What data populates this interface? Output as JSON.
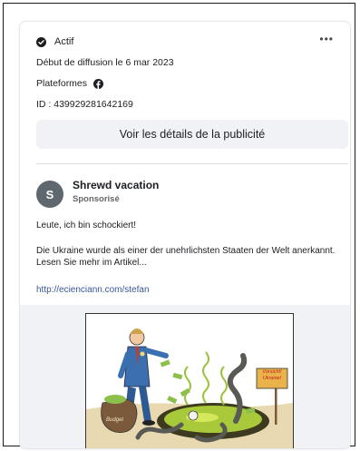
{
  "status": {
    "label": "Actif",
    "icon": "check-circle-icon"
  },
  "more_menu": {
    "label": "•••"
  },
  "info": {
    "start_date": "Début de diffusion le 6 mar 2023",
    "platforms_label": "Plateformes",
    "platform_icon": "facebook-icon",
    "id_text": "ID : 439929281642169"
  },
  "details_button": {
    "label": "Voir les détails de la publicité"
  },
  "advertiser": {
    "avatar_initial": "S",
    "name": "Shrewd vacation",
    "sponsored": "Sponsorisé"
  },
  "ad": {
    "text_line1": "Leute, ich bin schockiert!",
    "text_line2": "Die Ukraine wurde als einer der unehrlichsten Staaten der Welt anerkannt. Lesen Sie mehr im Artikel...",
    "link": "http://ecienciann.com/stefan"
  },
  "cartoon": {
    "sign_text": "Vorsicht! Ukraine!",
    "bag_text": "Budget"
  },
  "colors": {
    "accent_link": "#385898",
    "button_bg": "#f0f2f5",
    "avatar_bg": "#5f676f"
  }
}
